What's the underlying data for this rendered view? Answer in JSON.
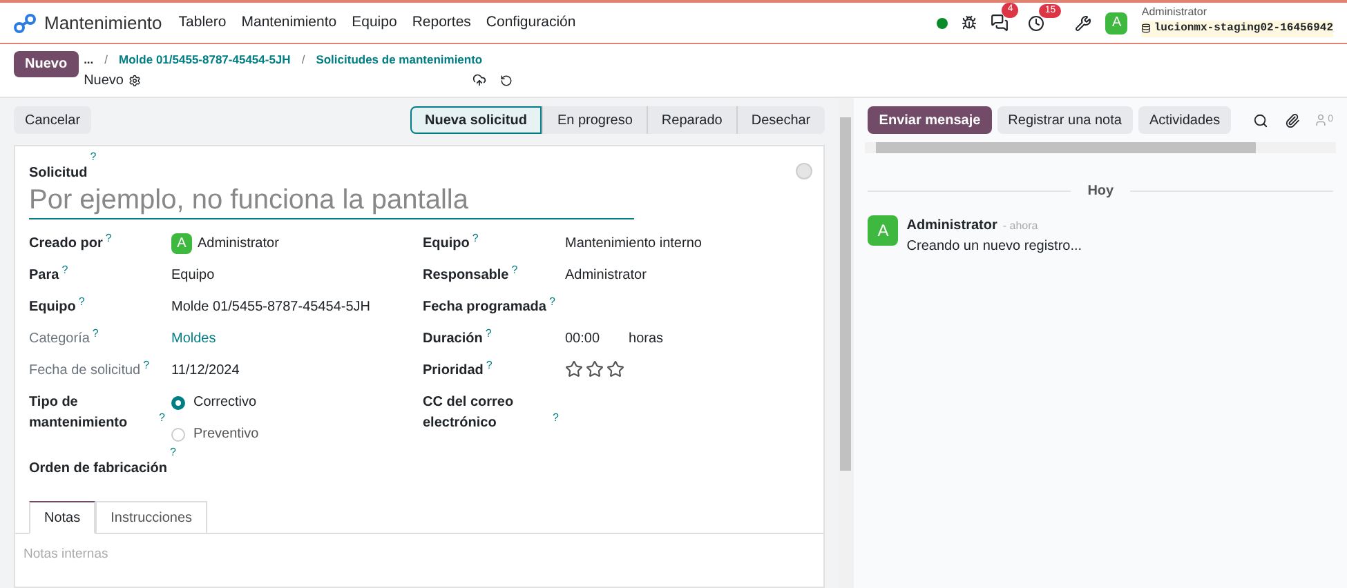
{
  "navbar": {
    "app": "Mantenimiento",
    "menu": [
      "Tablero",
      "Mantenimiento",
      "Equipo",
      "Reportes",
      "Configuración"
    ],
    "messages_count": "4",
    "activities_count": "15",
    "user": {
      "initial": "A",
      "name": "Administrator",
      "database": "lucionmx-staging02-16456942"
    }
  },
  "control_panel": {
    "new_button": "Nuevo",
    "breadcrumb_more": "...",
    "breadcrumbs": [
      {
        "separator": "/",
        "label": "Molde 01/5455-8787-45454-5JH"
      },
      {
        "separator": "/",
        "label": "Solicitudes de mantenimiento"
      }
    ],
    "record": "Nuevo"
  },
  "actions": {
    "cancel": "Cancelar",
    "stages": [
      {
        "label": "Nueva solicitud",
        "selected": true
      },
      {
        "label": "En progreso",
        "selected": false
      },
      {
        "label": "Reparado",
        "selected": false
      },
      {
        "label": "Desechar",
        "selected": false
      }
    ]
  },
  "form": {
    "title_label": "Solicitud",
    "title_help": "?",
    "title_placeholder": "Por ejemplo, no funciona la pantalla",
    "left": [
      {
        "label": "Creado por",
        "help": "?",
        "required": true,
        "kind": "avatar",
        "initial": "A",
        "value": "Administrator"
      },
      {
        "label": "Para",
        "help": "?",
        "required": true,
        "kind": "text",
        "value": "Equipo"
      },
      {
        "label": "Equipo",
        "help": "?",
        "required": true,
        "kind": "text",
        "value": "Molde 01/5455-8787-45454-5JH"
      },
      {
        "label": "Categoría",
        "help": "?",
        "required": false,
        "kind": "link",
        "value": "Moldes"
      },
      {
        "label": "Fecha de solicitud",
        "help": "?",
        "required": false,
        "kind": "text",
        "value": "11/12/2024"
      },
      {
        "label": "Tipo de mantenimiento",
        "help": "?",
        "required": true,
        "kind": "radio",
        "options": [
          {
            "label": "Correctivo",
            "selected": true
          },
          {
            "label": "Preventivo",
            "selected": false
          }
        ]
      }
    ],
    "right": [
      {
        "label": "Equipo",
        "help": "?",
        "required": true,
        "kind": "text",
        "value": "Mantenimiento interno"
      },
      {
        "label": "Responsable",
        "help": "?",
        "required": true,
        "kind": "text",
        "value": "Administrator"
      },
      {
        "label": "Fecha programada",
        "help": "?",
        "required": true,
        "kind": "empty"
      },
      {
        "label": "Duración",
        "help": "?",
        "required": true,
        "kind": "duration",
        "value": "00:00",
        "unit": "horas"
      },
      {
        "label": "Prioridad",
        "help": "?",
        "required": true,
        "kind": "stars",
        "stars": 0
      },
      {
        "label": "CC del correo electrónico",
        "help": "?",
        "required": true,
        "kind": "empty"
      }
    ],
    "bottom_field": "Orden de fabricación",
    "bottom_help": "?",
    "tabs": [
      {
        "label": "Notas",
        "selected": true
      },
      {
        "label": "Instrucciones",
        "selected": false
      }
    ],
    "notes_placeholder": "Notas internas"
  },
  "chatter": {
    "buttons": [
      {
        "label": "Enviar mensaje",
        "selected": true
      },
      {
        "label": "Registrar una nota",
        "selected": false
      },
      {
        "label": "Actividades",
        "selected": false
      }
    ],
    "followers": "0",
    "date_separator": "Hoy",
    "messages": [
      {
        "initial": "A",
        "author": "Administrator",
        "time": "- ahora",
        "body": "Creando un nuevo registro..."
      }
    ]
  }
}
